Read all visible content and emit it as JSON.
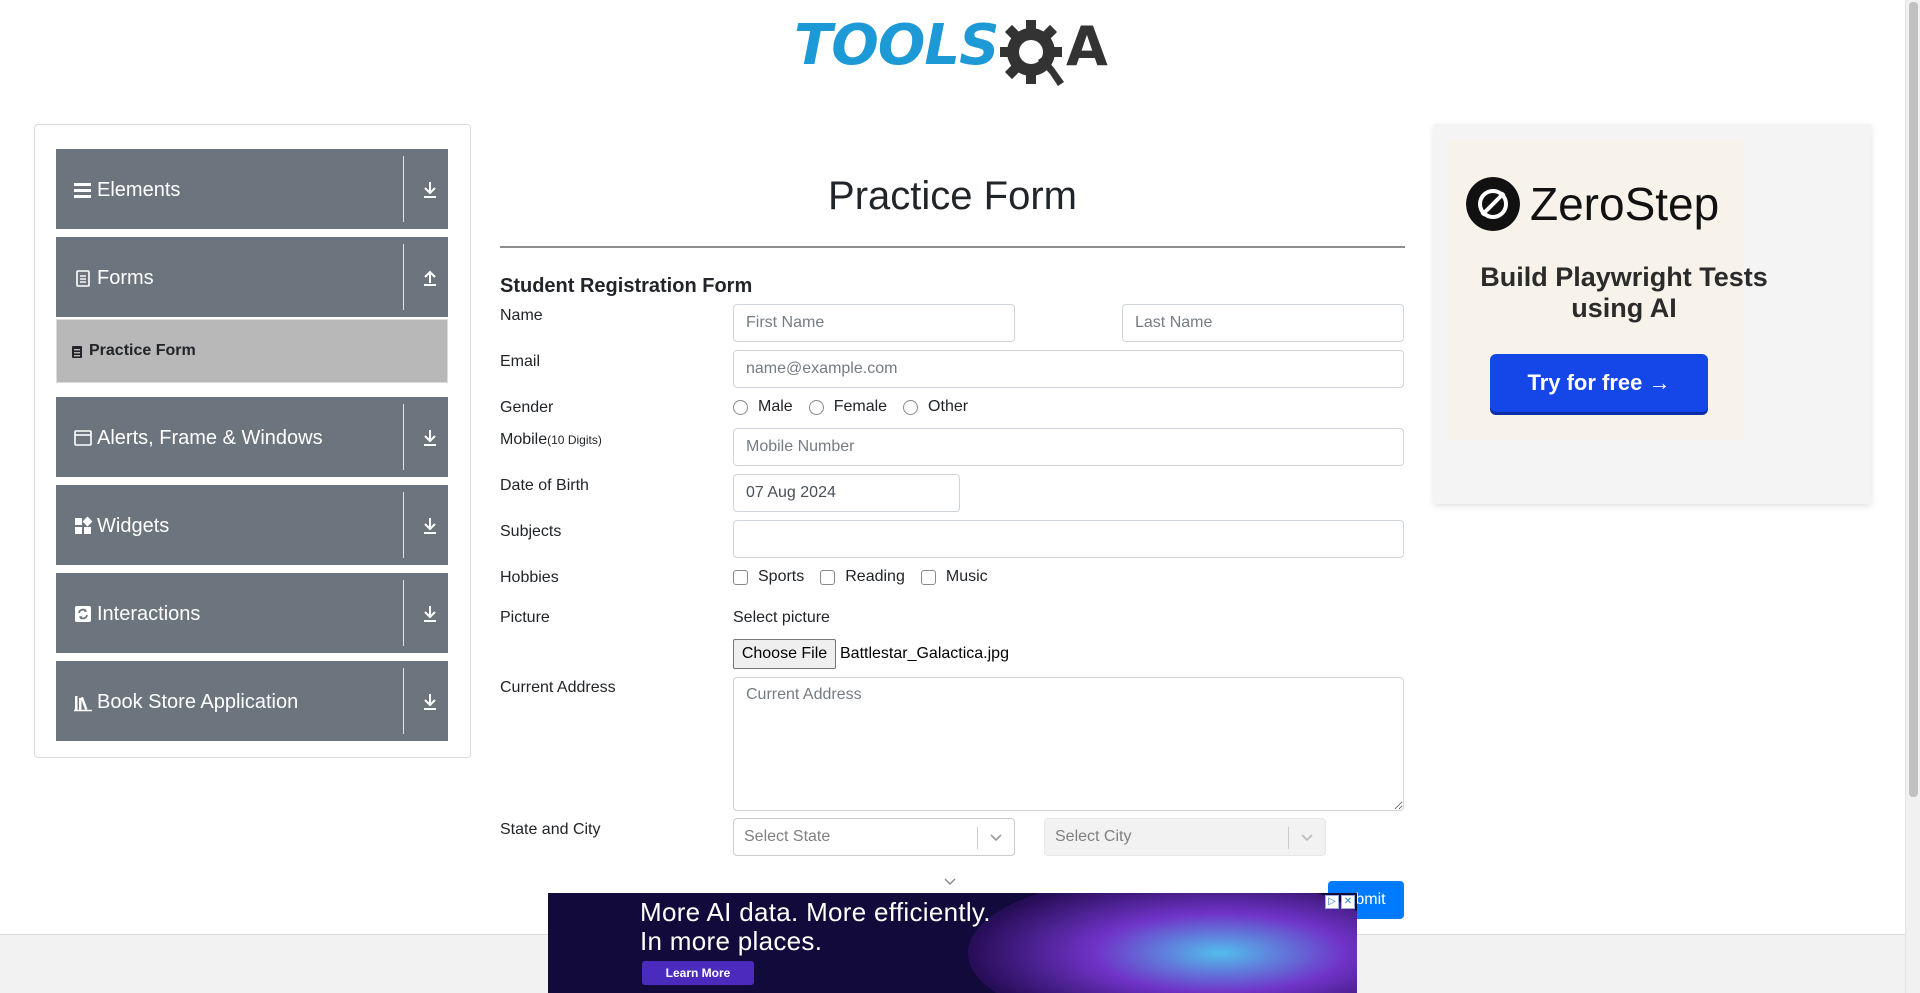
{
  "logo": {
    "text_left": "TOOLS",
    "text_right": "A"
  },
  "sidebar": {
    "groups": [
      {
        "label": "Elements",
        "icon": "hamburger-icon",
        "arrow": "download-icon"
      },
      {
        "label": "Forms",
        "icon": "form-icon",
        "arrow": "upload-icon"
      },
      {
        "label": "Alerts, Frame & Windows",
        "icon": "window-icon",
        "arrow": "download-icon"
      },
      {
        "label": "Widgets",
        "icon": "widgets-icon",
        "arrow": "download-icon"
      },
      {
        "label": "Interactions",
        "icon": "interactions-icon",
        "arrow": "download-icon"
      },
      {
        "label": "Book Store Application",
        "icon": "books-icon",
        "arrow": "download-icon"
      }
    ],
    "active_subitem": {
      "label": "Practice Form",
      "icon": "form-icon"
    }
  },
  "form": {
    "title": "Practice Form",
    "subtitle": "Student Registration Form",
    "labels": {
      "name": "Name",
      "email": "Email",
      "gender": "Gender",
      "mobile": "Mobile",
      "mobile_hint": "(10 Digits)",
      "dob": "Date of Birth",
      "subjects": "Subjects",
      "hobbies": "Hobbies",
      "picture": "Picture",
      "address": "Current Address",
      "state_city": "State and City"
    },
    "first_name_placeholder": "First Name",
    "last_name_placeholder": "Last Name",
    "email_placeholder": "name@example.com",
    "gender_options": [
      "Male",
      "Female",
      "Other"
    ],
    "mobile_placeholder": "Mobile Number",
    "dob_value": "07 Aug 2024",
    "subjects_value": "",
    "hobby_options": [
      "Sports",
      "Reading",
      "Music"
    ],
    "select_picture_label": "Select picture",
    "choose_file_label": "Choose File",
    "file_name": "Battlestar_Galactica.jpg",
    "address_placeholder": "Current Address",
    "state_placeholder": "Select State",
    "city_placeholder": "Select City",
    "submit_label": "ubmit"
  },
  "side_ad": {
    "brand": "ZeroStep",
    "tagline": "Build Playwright Tests using AI",
    "cta": "Try for free →"
  },
  "bottom_ad": {
    "headline_line1": "More AI data. More efficiently.",
    "headline_line2": "In more places.",
    "cta": "Learn More"
  },
  "colors": {
    "sidebar_group_bg": "#6c757d",
    "active_subitem_bg": "#b8b8b8",
    "primary": "#007bff",
    "logo_blue": "#1d9ad6",
    "zerostep_button": "#1446e8"
  }
}
